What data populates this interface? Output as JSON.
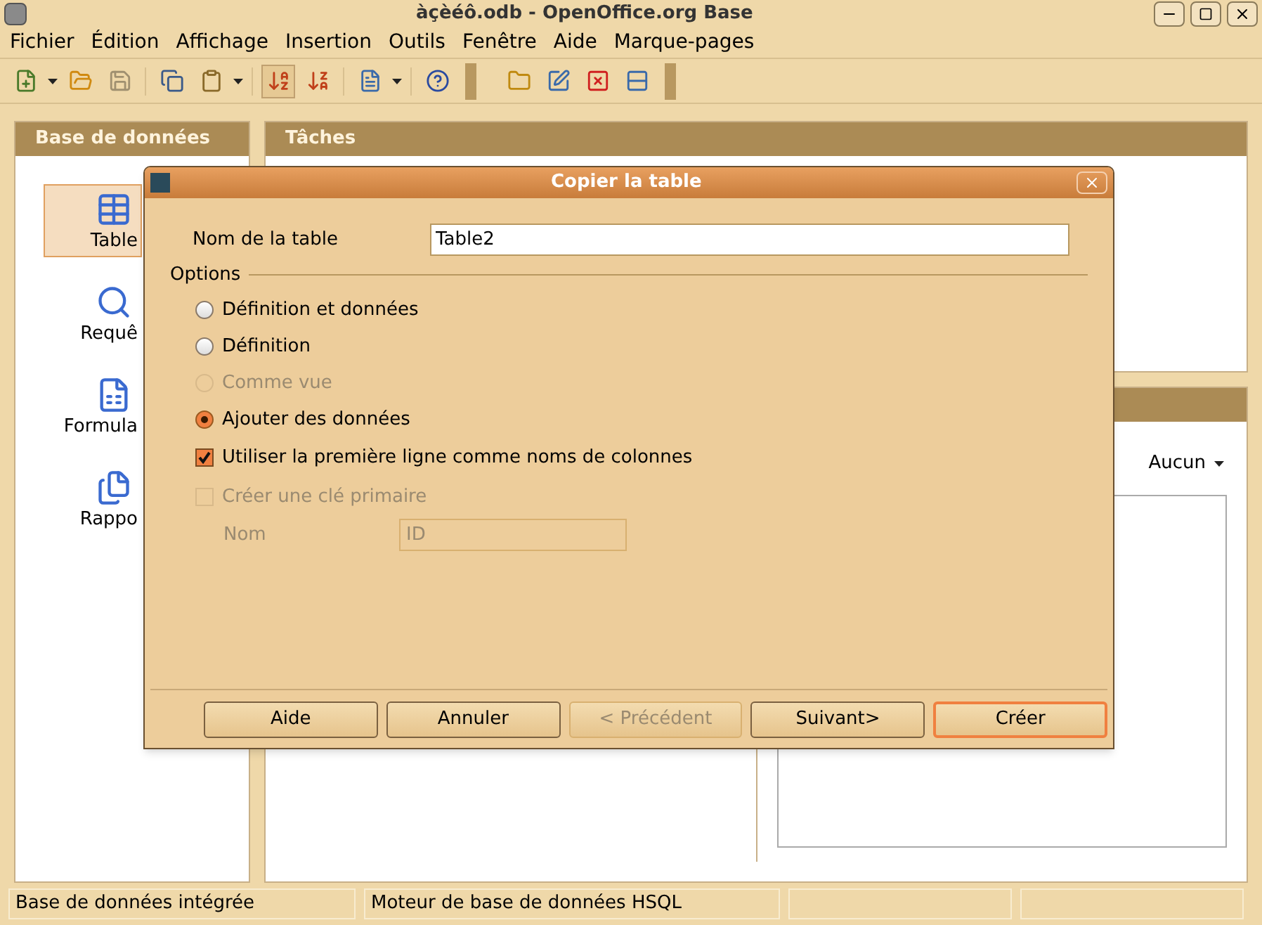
{
  "window": {
    "title": "àçèéô.odb - OpenOffice.org Base"
  },
  "menu": [
    "Fichier",
    "Édition",
    "Affichage",
    "Insertion",
    "Outils",
    "Fenêtre",
    "Aide",
    "Marque-pages"
  ],
  "left_panel": {
    "title": "Base de données",
    "items": [
      {
        "label": "Table",
        "selected": true
      },
      {
        "label": "Requê",
        "selected": false
      },
      {
        "label": "Formula",
        "selected": false
      },
      {
        "label": "Rappo",
        "selected": false
      }
    ]
  },
  "tasks_panel": {
    "title": "Tâches"
  },
  "preview": {
    "dropdown": "Aucun"
  },
  "dialog": {
    "title": "Copier la table",
    "table_name_label": "Nom de la table",
    "table_name_value": "Table2",
    "options_label": "Options",
    "radios": [
      {
        "label": "Définition et données",
        "selected": false,
        "disabled": false
      },
      {
        "label": "Définition",
        "selected": false,
        "disabled": false
      },
      {
        "label": "Comme vue",
        "selected": false,
        "disabled": true
      },
      {
        "label": "Ajouter des données",
        "selected": true,
        "disabled": false
      }
    ],
    "checkboxes": [
      {
        "label": "Utiliser la première ligne comme noms de colonnes",
        "checked": true,
        "disabled": false
      },
      {
        "label": "Créer une clé primaire",
        "checked": false,
        "disabled": true
      }
    ],
    "key_name": {
      "label": "Nom",
      "value": "ID",
      "disabled": true
    },
    "buttons": [
      {
        "label": "Aide",
        "disabled": false,
        "default": false
      },
      {
        "label": "Annuler",
        "disabled": false,
        "default": false
      },
      {
        "label": "< Précédent",
        "disabled": true,
        "default": false
      },
      {
        "label": "Suivant>",
        "disabled": false,
        "default": false
      },
      {
        "label": "Créer",
        "disabled": false,
        "default": true
      }
    ]
  },
  "status_bar": [
    "Base de données intégrée",
    "Moteur de base de données HSQL"
  ]
}
